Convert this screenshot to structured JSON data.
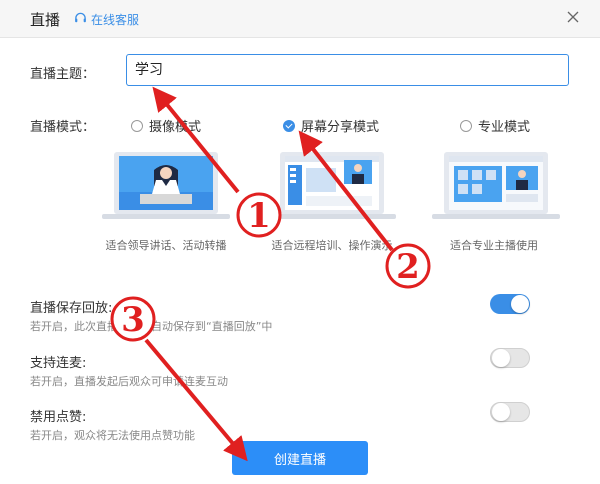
{
  "header": {
    "title": "直播",
    "support_label": "在线客服"
  },
  "form": {
    "topic_label": "直播主题：",
    "topic_value": "学习",
    "mode_label": "直播模式："
  },
  "modes": [
    {
      "label": "摄像模式",
      "selected": false,
      "desc": "适合领导讲话、活动转播"
    },
    {
      "label": "屏幕分享模式",
      "selected": true,
      "desc": "适合远程培训、操作演示"
    },
    {
      "label": "专业模式",
      "selected": false,
      "desc": "适合专业主播使用"
    }
  ],
  "options": [
    {
      "title": "直播保存回放:",
      "desc": "若开启，此次直播回放将自动保存到“直播回放”中",
      "enabled": true
    },
    {
      "title": "支持连麦:",
      "desc": "若开启，直播发起后观众可申请连麦互动",
      "enabled": false
    },
    {
      "title": "禁用点赞:",
      "desc": "若开启，观众将无法使用点赞功能",
      "enabled": false
    }
  ],
  "actions": {
    "create_label": "创建直播"
  },
  "annotations": {
    "step1": "1",
    "step2": "2",
    "step3": "3"
  },
  "colors": {
    "accent": "#3a8ee6",
    "annotation_red": "#e02020"
  }
}
